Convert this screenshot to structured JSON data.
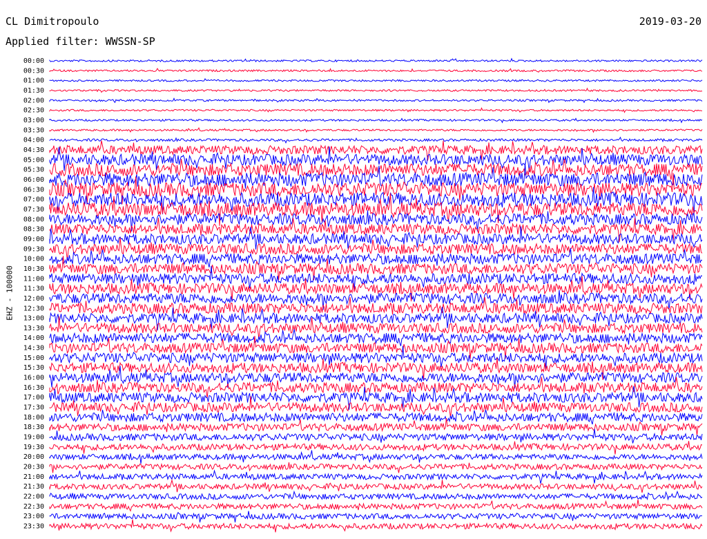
{
  "header": {
    "station": "CL Dimitropoulo",
    "filter_label": "Applied filter: WWSSN-SP",
    "date": "2019-03-20"
  },
  "colors": {
    "trace_a": "#0000ff",
    "trace_b": "#ff0033",
    "background": "#ffffff"
  },
  "chart_data": {
    "type": "line",
    "title": "",
    "channel_label": "EHZ - 100000",
    "ylabel": "EHZ - 100000",
    "row_labels": [
      "00:00",
      "00:30",
      "01:00",
      "01:30",
      "02:00",
      "02:30",
      "03:00",
      "03:30",
      "04:00",
      "04:30",
      "05:00",
      "05:30",
      "06:00",
      "06:30",
      "07:00",
      "07:30",
      "08:00",
      "08:30",
      "09:00",
      "09:30",
      "10:00",
      "10:30",
      "11:00",
      "11:30",
      "12:00",
      "12:30",
      "13:00",
      "13:30",
      "14:00",
      "14:30",
      "15:00",
      "15:30",
      "16:00",
      "16:30",
      "17:00",
      "17:30",
      "18:00",
      "18:30",
      "19:00",
      "19:30",
      "20:00",
      "20:30",
      "21:00",
      "21:30",
      "22:00",
      "22:30",
      "23:00",
      "23:30"
    ],
    "row_minutes": 30,
    "series_colors": [
      "#0000ff",
      "#ff0033"
    ],
    "relative_amplitude": [
      0.15,
      0.15,
      0.15,
      0.15,
      0.15,
      0.15,
      0.15,
      0.15,
      0.2,
      0.7,
      0.9,
      1.0,
      1.1,
      1.1,
      1.1,
      1.1,
      0.9,
      0.85,
      0.85,
      0.85,
      0.85,
      0.85,
      0.85,
      0.85,
      0.85,
      0.85,
      0.8,
      0.8,
      0.8,
      0.8,
      0.8,
      0.8,
      0.8,
      0.8,
      0.8,
      0.75,
      0.7,
      0.6,
      0.55,
      0.5,
      0.45,
      0.45,
      0.45,
      0.45,
      0.45,
      0.45,
      0.45,
      0.45
    ],
    "grid": false
  }
}
